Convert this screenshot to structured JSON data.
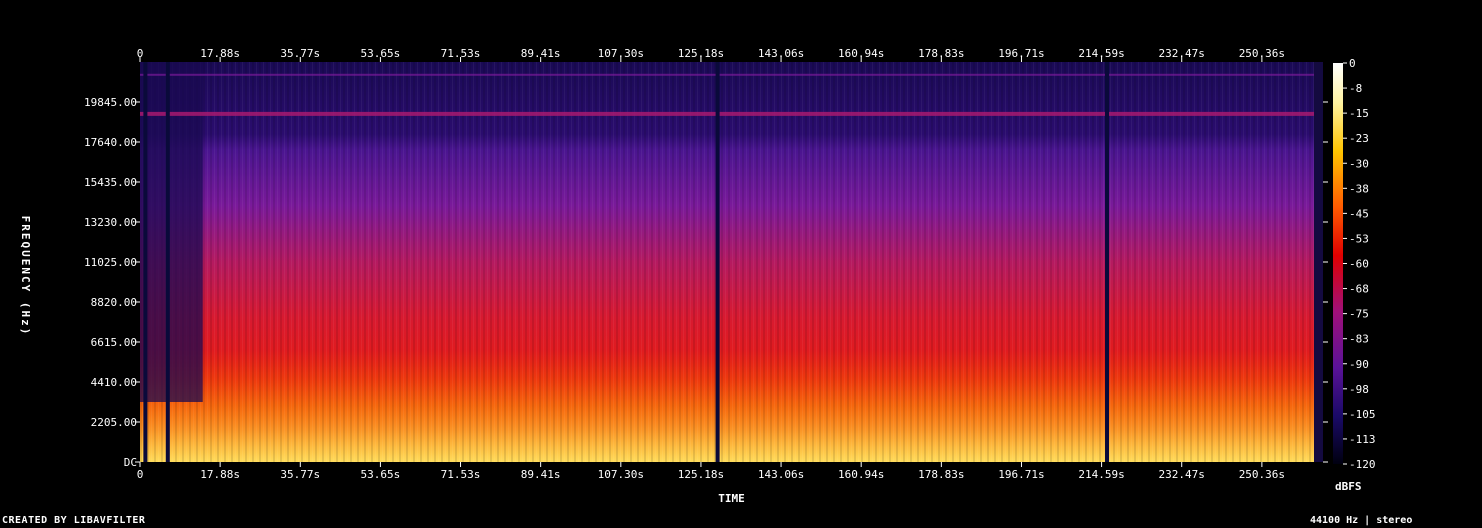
{
  "chart_data": {
    "type": "heatmap",
    "title": "",
    "xlabel": "TIME",
    "ylabel": "FREQUENCY (Hz)",
    "x_ticks": [
      "0",
      "17.88s",
      "35.77s",
      "53.65s",
      "71.53s",
      "89.41s",
      "107.30s",
      "125.18s",
      "143.06s",
      "160.94s",
      "178.83s",
      "196.71s",
      "214.59s",
      "232.47s",
      "250.36s"
    ],
    "x_tick_values": [
      0,
      17.88,
      35.77,
      53.65,
      71.53,
      89.41,
      107.3,
      125.18,
      143.06,
      160.94,
      178.83,
      196.71,
      214.59,
      232.47,
      250.36
    ],
    "xlim": [
      0,
      264
    ],
    "y_ticks": [
      "DC",
      "2205.00",
      "4410.00",
      "6615.00",
      "8820.00",
      "11025.00",
      "13230.00",
      "15435.00",
      "17640.00",
      "19845.00"
    ],
    "y_tick_values": [
      0,
      2205,
      4410,
      6615,
      8820,
      11025,
      13230,
      15435,
      17640,
      19845
    ],
    "ylim": [
      0,
      22050
    ],
    "colorbar": {
      "label": "dBFS",
      "ticks": [
        "0",
        "-8",
        "-15",
        "-23",
        "-30",
        "-38",
        "-45",
        "-53",
        "-60",
        "-68",
        "-75",
        "-83",
        "-90",
        "-98",
        "-105",
        "-113",
        "-120"
      ],
      "range": [
        -120,
        0
      ]
    },
    "gaps_seconds": [
      1.2,
      6.2,
      128.9,
      215.8
    ],
    "audio_end_seconds": 262
  },
  "footer": {
    "credit": "CREATED BY LIBAVFILTER",
    "info": "44100 Hz | stereo"
  }
}
